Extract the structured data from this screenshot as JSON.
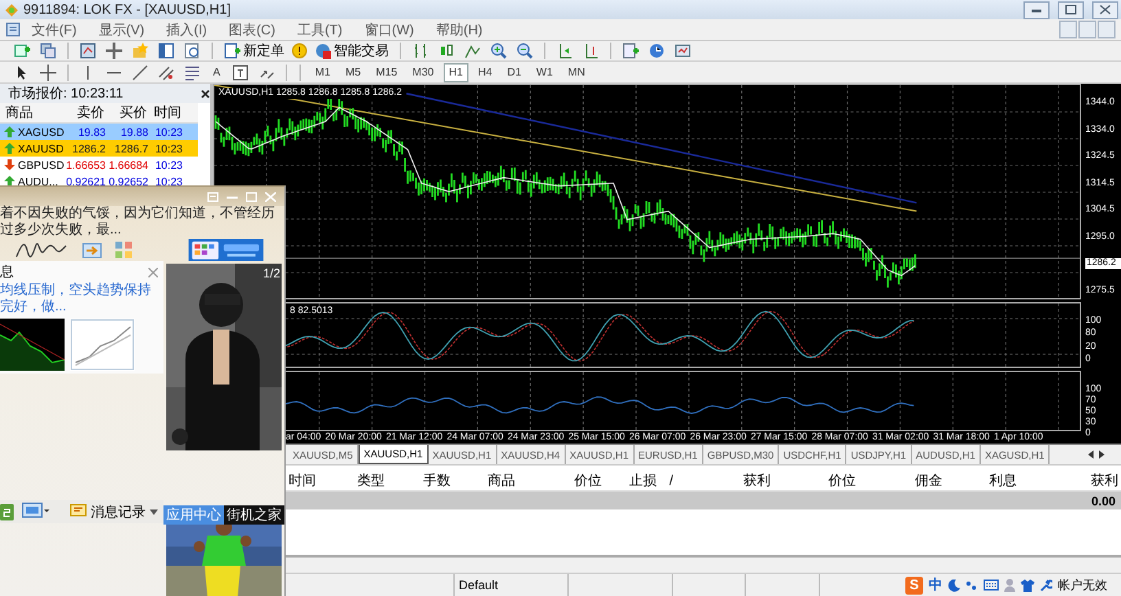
{
  "window": {
    "title": "9911894: LOK FX - [XAUUSD,H1]"
  },
  "menu": [
    "文件(F)",
    "显示(V)",
    "插入(I)",
    "图表(C)",
    "工具(T)",
    "窗口(W)",
    "帮助(H)"
  ],
  "toolbar": {
    "buttons": [
      "新定单",
      "智能交易"
    ],
    "text_tool": "A"
  },
  "timeframes": [
    {
      "label": "M1",
      "selected": false
    },
    {
      "label": "M5",
      "selected": false
    },
    {
      "label": "M15",
      "selected": false
    },
    {
      "label": "M30",
      "selected": false
    },
    {
      "label": "H1",
      "selected": true
    },
    {
      "label": "H4",
      "selected": false
    },
    {
      "label": "D1",
      "selected": false
    },
    {
      "label": "W1",
      "selected": false
    },
    {
      "label": "MN",
      "selected": false
    }
  ],
  "market_watch": {
    "title": "市场报价: 10:23:11",
    "columns": [
      "商品",
      "卖价",
      "买价",
      "时间"
    ],
    "rows": [
      {
        "symbol": "XAGUSD",
        "bid": "19.83",
        "ask": "19.88",
        "time": "10:23",
        "rising": true,
        "selected": true,
        "flagged": false
      },
      {
        "symbol": "XAUUSD",
        "bid": "1286.2",
        "ask": "1286.7",
        "time": "10:23",
        "rising": true,
        "selected": false,
        "flagged": true
      },
      {
        "symbol": "GBPUSD",
        "bid": "1.66653",
        "ask": "1.66684",
        "time": "10:23",
        "rising": false,
        "selected": false,
        "flagged": false
      },
      {
        "symbol": "AUDU...",
        "bid": "0.92621",
        "ask": "0.92652",
        "time": "10:23",
        "rising": true,
        "selected": false,
        "flagged": false
      }
    ]
  },
  "chart": {
    "header": "XAUUSD,H1 1285.8 1286.8 1285.8 1286.2",
    "price_labels": [
      {
        "text": "1344.0",
        "current": false
      },
      {
        "text": "1334.0",
        "current": false
      },
      {
        "text": "1324.5",
        "current": false
      },
      {
        "text": "1314.5",
        "current": false
      },
      {
        "text": "1304.5",
        "current": false
      },
      {
        "text": "1295.0",
        "current": false
      },
      {
        "text": "1286.2",
        "current": true
      },
      {
        "text": "1275.5",
        "current": false
      }
    ],
    "indicator_header": "8 82.5013",
    "stoch_labels": [
      "100",
      "80",
      "20",
      "0"
    ],
    "osc_labels": [
      "100",
      "70",
      "50",
      "30",
      "0"
    ],
    "time_labels": [
      "ar 04:00",
      "20 Mar 20:00",
      "21 Mar 12:00",
      "24 Mar 07:00",
      "24 Mar 23:00",
      "25 Mar 15:00",
      "26 Mar 07:00",
      "26 Mar 23:00",
      "27 Mar 15:00",
      "28 Mar 07:00",
      "31 Mar 02:00",
      "31 Mar 18:00",
      "1 Apr 10:00"
    ]
  },
  "chart_tabs": [
    {
      "label": "XAUUSD,M5",
      "selected": false
    },
    {
      "label": "XAUUSD,H1",
      "selected": true
    },
    {
      "label": "XAUUSD,H1",
      "selected": false
    },
    {
      "label": "XAUUSD,H4",
      "selected": false
    },
    {
      "label": "XAUUSD,H1",
      "selected": false
    },
    {
      "label": "EURUSD,H1",
      "selected": false
    },
    {
      "label": "GBPUSD,M30",
      "selected": false
    },
    {
      "label": "USDCHF,H1",
      "selected": false
    },
    {
      "label": "USDJPY,H1",
      "selected": false
    },
    {
      "label": "AUDUSD,H1",
      "selected": false
    },
    {
      "label": "XAGUSD,H1",
      "selected": false
    }
  ],
  "terminal": {
    "columns": [
      "时间",
      "类型",
      "手数",
      "商品",
      "价位",
      "止损",
      "/",
      "获利",
      "价位",
      "佣金",
      "利息",
      "获利"
    ],
    "total": "0.00"
  },
  "status_bar": {
    "profile": "Default",
    "ime_logo": "S",
    "ime_mode": "中",
    "account": "帐户无效"
  },
  "chat": {
    "quote": "着不因失败的气馁，因为它们知道，不管经历过多少次失败，最...",
    "panel_title": "息",
    "link": "均线压制，空头趋势保持完好，做...",
    "photo_counter": "1/2",
    "history_button": "消息记录",
    "app_labels": [
      "应用中心",
      "街机之家"
    ]
  }
}
